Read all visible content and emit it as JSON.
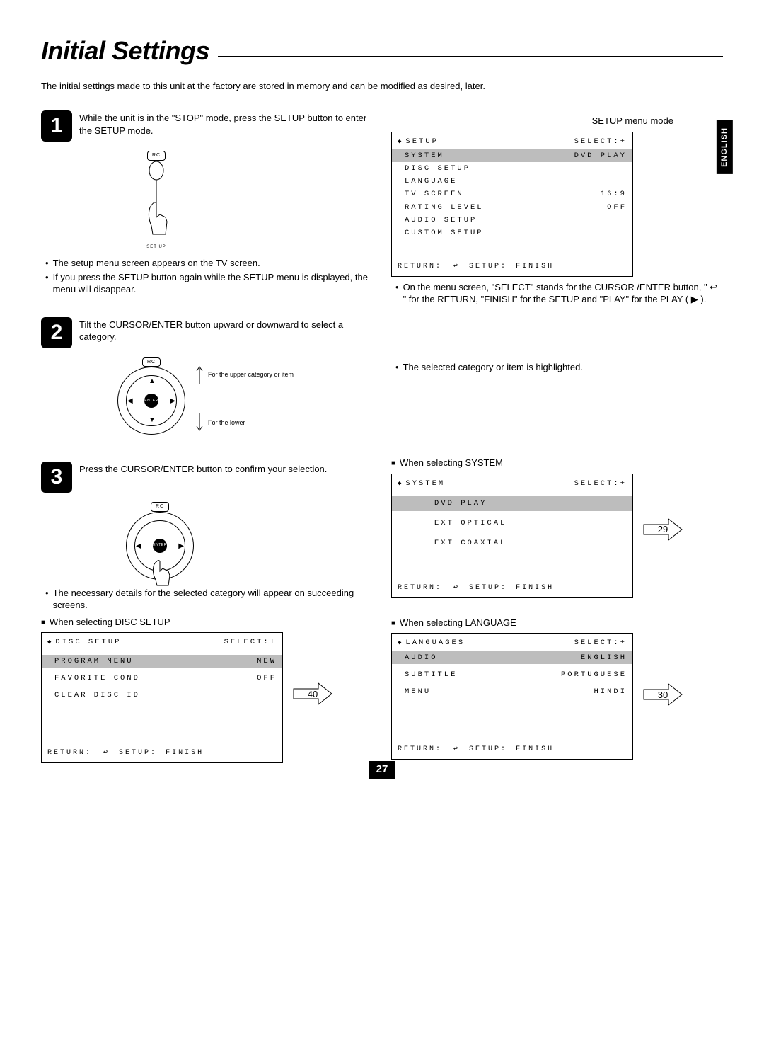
{
  "page": {
    "title": "Initial Settings",
    "intro": "The initial settings made to this unit at the factory are stored in memory and can be modified as desired, later.",
    "number": "27",
    "lang_tab": "ENGLISH"
  },
  "labels": {
    "rc": "RC",
    "setup": "SET UP",
    "enter": "ENTER"
  },
  "step1": {
    "text": "While the unit is in the \"STOP\" mode, press the SETUP button to enter the SETUP mode.",
    "b1": "The setup menu screen appears on the TV screen.",
    "b2": "If you press the SETUP button again while the SETUP menu is displayed, the menu will disappear."
  },
  "setup_menu": {
    "caption": "SETUP menu mode",
    "header_left": "SETUP",
    "header_right": "SELECT:+",
    "rows": [
      {
        "k": "SYSTEM",
        "v": "DVD PLAY",
        "hl": true
      },
      {
        "k": "DISC SETUP",
        "v": ""
      },
      {
        "k": "LANGUAGE",
        "v": ""
      },
      {
        "k": "TV SCREEN",
        "v": "16:9"
      },
      {
        "k": "RATING LEVEL",
        "v": "OFF"
      },
      {
        "k": "AUDIO SETUP",
        "v": ""
      },
      {
        "k": "CUSTOM SETUP",
        "v": ""
      }
    ],
    "footer": {
      "return": "RETURN:",
      "setup": "SETUP:",
      "finish": "FINISH"
    },
    "note": "On the menu screen, \"SELECT\" stands for the CURSOR /ENTER button, \" ↩ \" for the RETURN, \"FINISH\" for the SETUP and \"PLAY\" for the PLAY ( ▶ )."
  },
  "step2": {
    "text": "Tilt the CURSOR/ENTER button upward or downward to select a category.",
    "upper": "For the upper category or item",
    "lower": "For the lower",
    "note": "The selected category or item is highlighted."
  },
  "step3": {
    "text": "Press the CURSOR/ENTER button to confirm your selection.",
    "note": "The necessary details for the selected category will appear on succeeding screens."
  },
  "system_menu": {
    "caption": "When selecting SYSTEM",
    "header_left": "SYSTEM",
    "header_right": "SELECT:+",
    "opts": [
      {
        "t": "DVD PLAY",
        "hl": true
      },
      {
        "t": "EXT OPTICAL"
      },
      {
        "t": "EXT COAXIAL"
      }
    ],
    "callout": "29"
  },
  "disc_menu": {
    "caption": "When selecting DISC SETUP",
    "header_left": "DISC SETUP",
    "header_right": "SELECT:+",
    "rows": [
      {
        "k": "PROGRAM MENU",
        "v": "NEW",
        "hl": true
      },
      {
        "k": "FAVORITE COND",
        "v": "OFF"
      },
      {
        "k": "CLEAR DISC ID",
        "v": ""
      }
    ],
    "callout": "40"
  },
  "lang_menu": {
    "caption": "When selecting LANGUAGE",
    "header_left": "LANGUAGES",
    "header_right": "SELECT:+",
    "rows": [
      {
        "k": "AUDIO",
        "v": "ENGLISH",
        "hl": true
      },
      {
        "k": "SUBTITLE",
        "v": "PORTUGUESE"
      },
      {
        "k": "MENU",
        "v": "HINDI"
      }
    ],
    "callout": "30"
  }
}
